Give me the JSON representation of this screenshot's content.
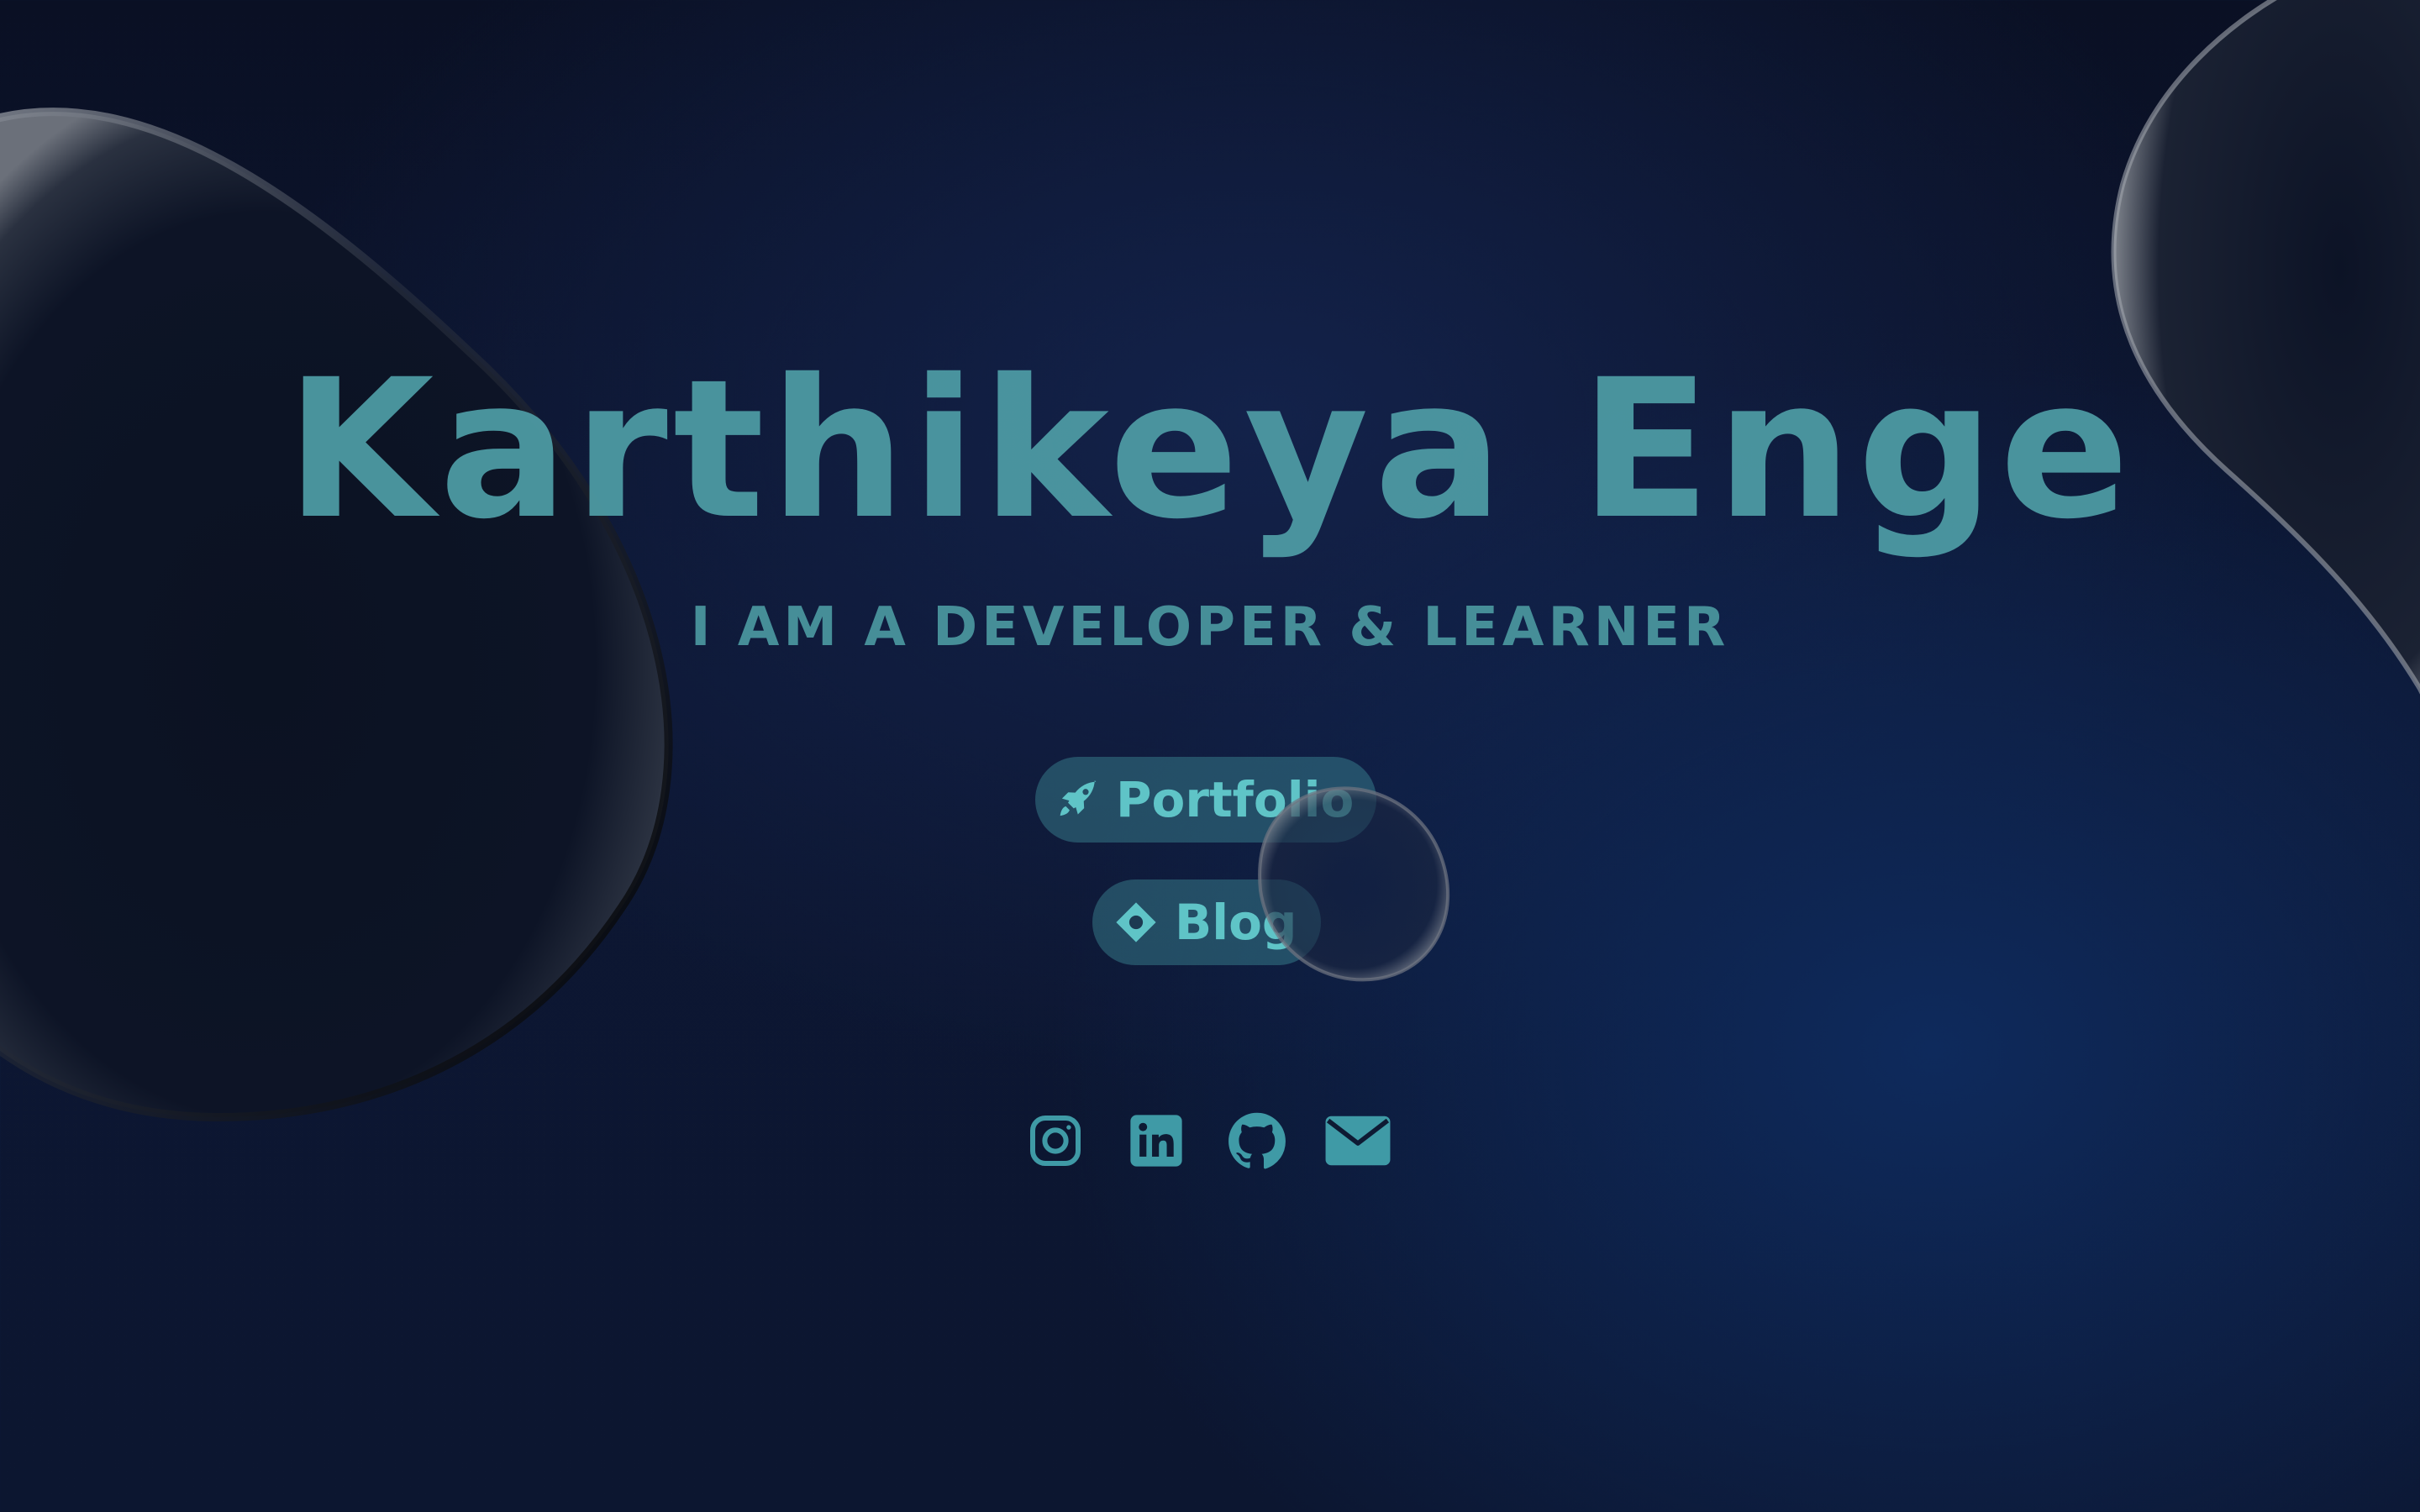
{
  "hero": {
    "name": "Karthikeya Enge",
    "tagline": "I AM A DEVELOPER & LEARNER"
  },
  "actions": {
    "portfolio": {
      "label": "Portfolio",
      "icon": "rocket-icon"
    },
    "blog": {
      "label": "Blog",
      "icon": "diamond-icon"
    }
  },
  "social": [
    {
      "icon": "instagram-icon"
    },
    {
      "icon": "linkedin-icon"
    },
    {
      "icon": "github-icon"
    },
    {
      "icon": "mail-icon"
    }
  ],
  "colors": {
    "accent": "#5fc4c7",
    "title": "#4d9aa3",
    "background": "#0d1733"
  }
}
